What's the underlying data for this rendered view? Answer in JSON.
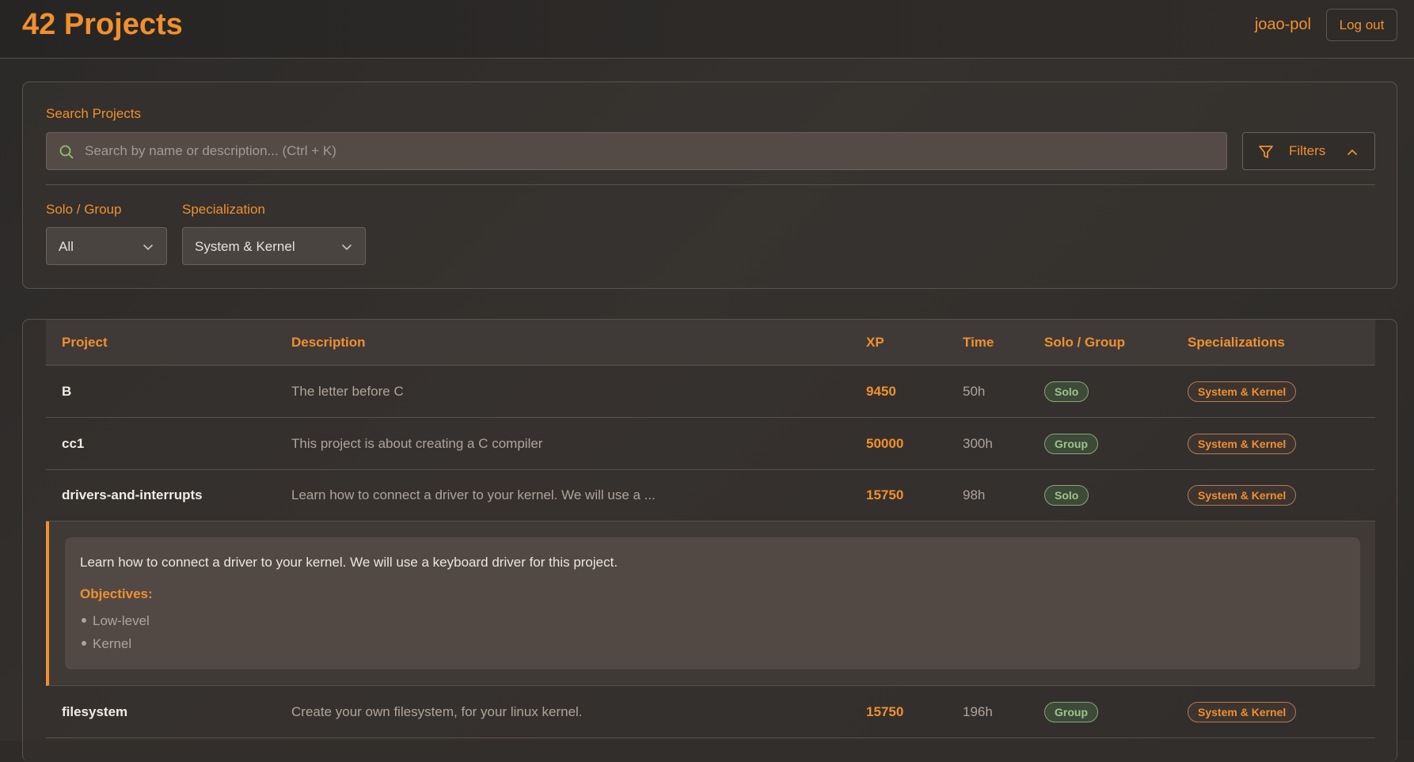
{
  "header": {
    "title": "42 Projects",
    "username": "joao-pol",
    "logout_label": "Log out"
  },
  "search": {
    "label": "Search Projects",
    "placeholder": "Search by name or description... (Ctrl + K)",
    "value": "",
    "search_icon": "search-icon",
    "filters_label": "Filters",
    "filters_icon": "funnel-icon",
    "filters_chevron": "chevron-up-icon"
  },
  "filters": {
    "solo_group": {
      "label": "Solo / Group",
      "selected": "All"
    },
    "specialization": {
      "label": "Specialization",
      "selected": "System & Kernel"
    }
  },
  "table": {
    "columns": [
      "Project",
      "Description",
      "XP",
      "Time",
      "Solo / Group",
      "Specializations"
    ],
    "rows": [
      {
        "name": "B",
        "description": "The letter before C",
        "xp": "9450",
        "time": "50h",
        "type": "Solo",
        "specialization": "System & Kernel"
      },
      {
        "name": "cc1",
        "description": "This project is about creating a C compiler",
        "xp": "50000",
        "time": "300h",
        "type": "Group",
        "specialization": "System & Kernel"
      },
      {
        "name": "drivers-and-interrupts",
        "description": "Learn how to connect a driver to your kernel. We will use a ...",
        "xp": "15750",
        "time": "98h",
        "type": "Solo",
        "specialization": "System & Kernel"
      },
      {
        "name": "filesystem",
        "description": "Create your own filesystem, for your linux kernel.",
        "xp": "15750",
        "time": "196h",
        "type": "Group",
        "specialization": "System & Kernel"
      }
    ],
    "expanded": {
      "description": "Learn how to connect a driver to your kernel. We will use a keyboard driver for this project.",
      "objectives_label": "Objectives:",
      "objectives": [
        "Low-level",
        "Kernel"
      ]
    }
  },
  "colors": {
    "accent": "#f0902e",
    "solo_group_badge": "#9ec48a"
  }
}
